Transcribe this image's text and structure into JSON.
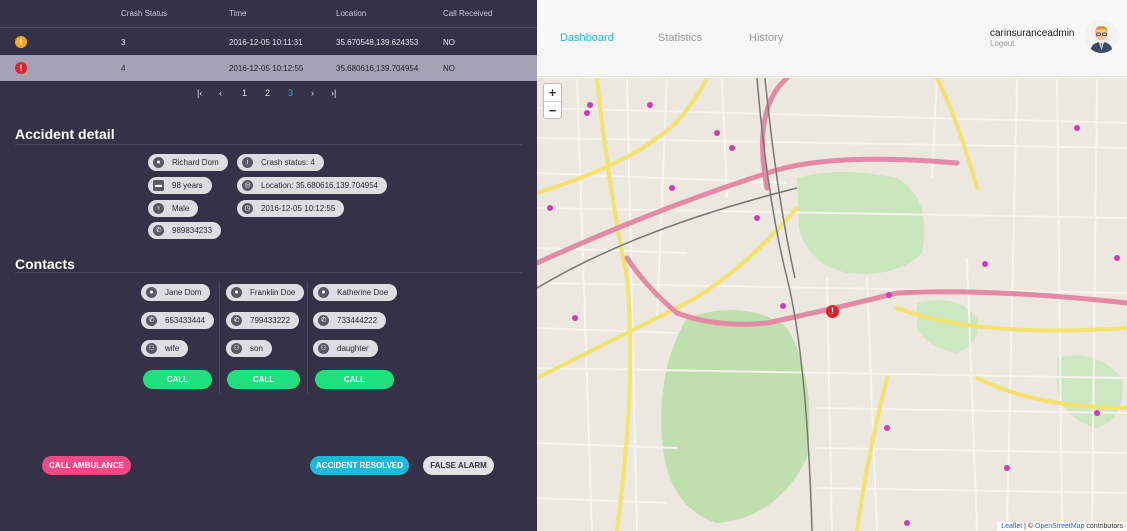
{
  "table": {
    "headers": [
      "Crash Status",
      "Time",
      "Location",
      "Call Received"
    ],
    "rows": [
      {
        "status": "3",
        "time": "2016-12-05 10:11:31",
        "location": "35.670548,139.624353",
        "call": "NO",
        "icon": "!",
        "icon_color": "#f5a623"
      },
      {
        "status": "4",
        "time": "2016-12-05 10:12:55",
        "location": "35.680616,139.704954",
        "call": "NO",
        "icon": "!",
        "icon_color": "#e0202b"
      }
    ]
  },
  "pager": {
    "first": "|‹",
    "prev": "‹",
    "pages": [
      "1",
      "2",
      "3"
    ],
    "active_page": "3",
    "next": "›",
    "last": "›|"
  },
  "accident": {
    "title": "Accident detail",
    "name": "Richard Dom",
    "age": "98 years",
    "gender": "Male",
    "phone": "989834233",
    "crash_status": "Crash status: 4",
    "location": "Location: 35.680616,139.704954",
    "time": "2016-12-05 10:12:55"
  },
  "contacts": {
    "title": "Contacts",
    "items": [
      {
        "name": "Jane Dom",
        "phone": "653433444",
        "relation": "wife",
        "call": "CALL"
      },
      {
        "name": "Franklin Doe",
        "phone": "799433222",
        "relation": "son",
        "call": "CALL"
      },
      {
        "name": "Katherine Doe",
        "phone": "733444222",
        "relation": "daughter",
        "call": "CALL"
      }
    ]
  },
  "actions": {
    "ambulance": "CALL AMBULANCE",
    "resolved": "ACCIDENT RESOLVED",
    "false_alarm": "FALSE ALARM"
  },
  "nav": {
    "dashboard": "Dashboard",
    "statistics": "Statistics",
    "history": "History"
  },
  "user": {
    "name": "carinsuranceadmin",
    "logout": "Logout"
  },
  "map": {
    "zoom_in": "+",
    "zoom_out": "−",
    "attribution_leaflet": "Leaflet",
    "attribution_sep": " | © ",
    "attribution_osm": "OpenStreetMap",
    "attribution_tail": " contributors",
    "marker": "!"
  },
  "colors": {
    "panel": "#353146",
    "accent": "#22b6e0",
    "green": "#1ee07e",
    "pink": "#ef4a86",
    "cyan": "#1fb8d8",
    "alert_red": "#e0202b",
    "alert_orange": "#f5a623"
  }
}
